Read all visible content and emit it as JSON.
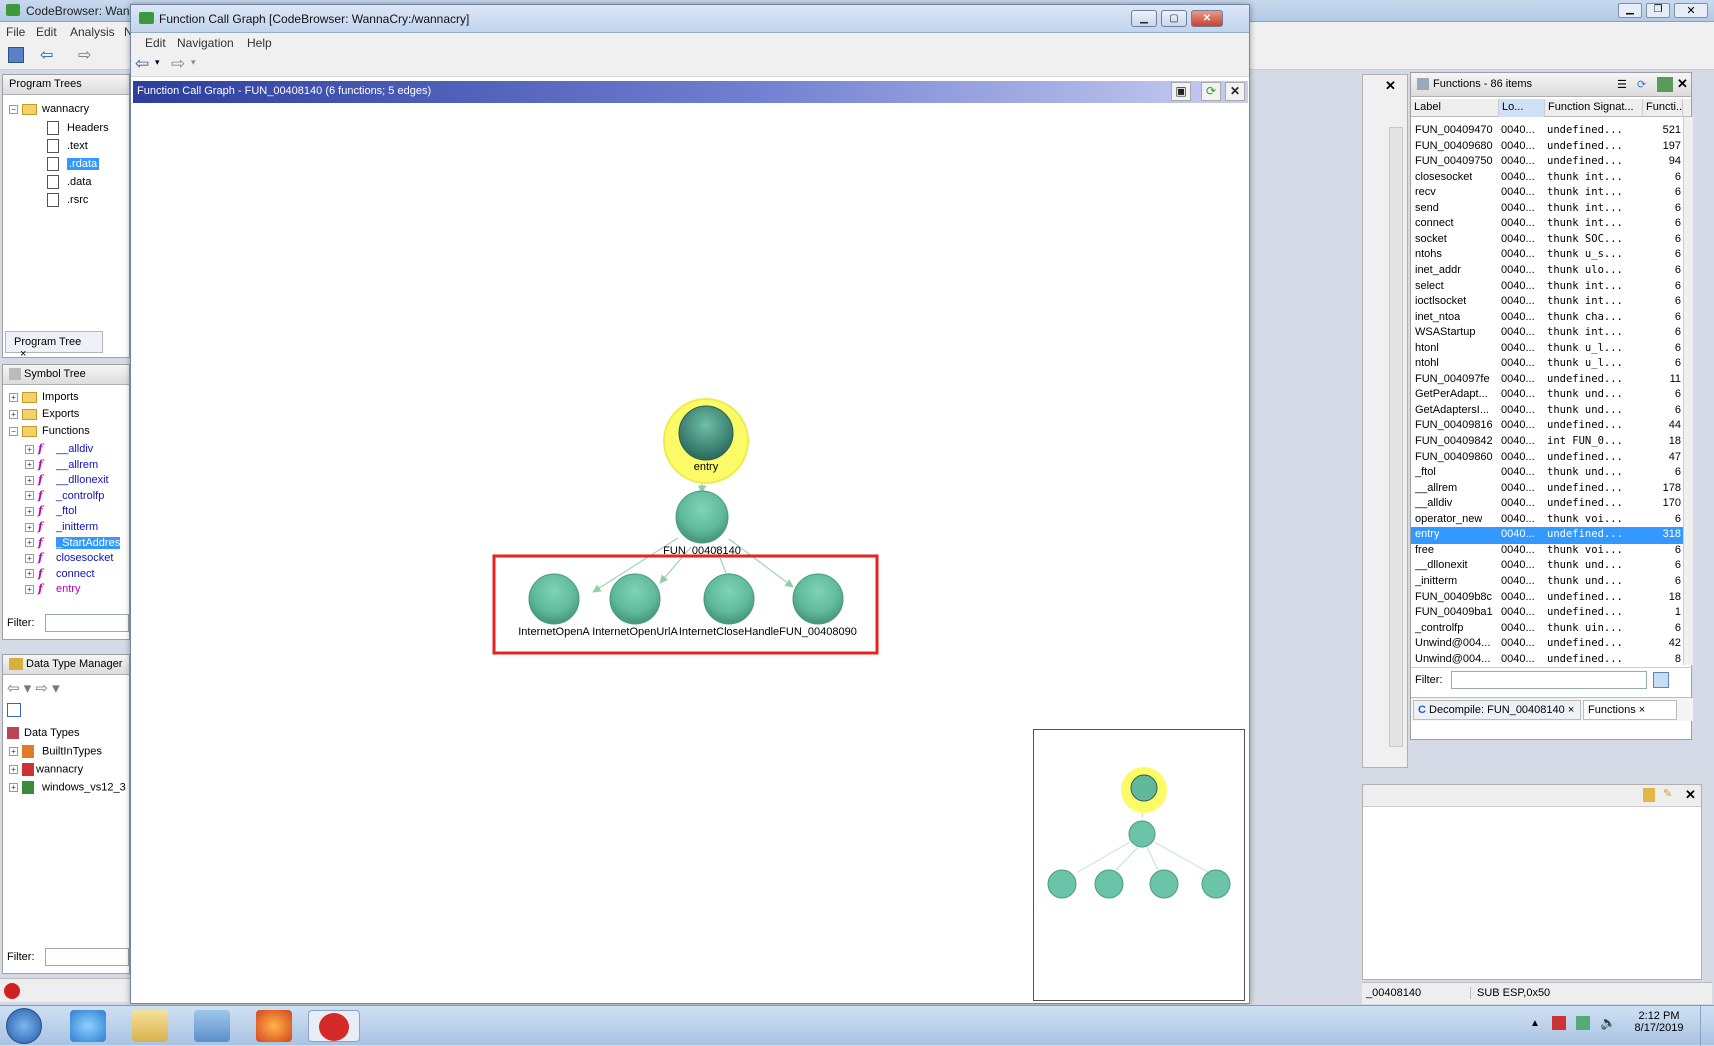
{
  "codebrowser": {
    "title": "CodeBrowser: Wann",
    "menu": [
      "File",
      "Edit",
      "Analysis",
      "N"
    ]
  },
  "program_trees": {
    "title": "Program Trees",
    "root": "wannacry",
    "items": [
      "Headers",
      ".text",
      ".rdata",
      ".data",
      ".rsrc"
    ],
    "tab": "Program Tree"
  },
  "symbol_tree": {
    "title": "Symbol Tree",
    "folders": [
      "Imports",
      "Exports",
      "Functions"
    ],
    "functions": [
      "__alldiv",
      "__allrem",
      "__dllonexit",
      "_controlfp",
      "_ftol",
      "_initterm",
      "_StartAddres",
      "closesocket",
      "connect",
      "entry"
    ],
    "filter_label": "Filter:"
  },
  "data_type_manager": {
    "title": "Data Type Manager",
    "root": "Data Types",
    "items": [
      "BuiltInTypes",
      "wannacry",
      "windows_vs12_3"
    ],
    "filter_label": "Filter:"
  },
  "fcg_window": {
    "title": "Function Call Graph [CodeBrowser: WannaCry:/wannacry]",
    "menu": [
      "Edit",
      "Navigation",
      "Help"
    ],
    "panel_title": "Function Call Graph - FUN_00408140 (6 functions; 5 edges)"
  },
  "graph": {
    "root": "entry",
    "caller": "FUN_00408140",
    "callees": [
      "InternetOpenA",
      "InternetOpenUrlA",
      "InternetCloseHandle",
      "FUN_00408090"
    ],
    "node_color": "#6cc4a8",
    "highlight_color": "#ffff66",
    "box_color": "#e8231f"
  },
  "functions_panel": {
    "title": "Functions - 86 items",
    "columns": [
      "Label",
      "Lo...",
      "Function Signat...",
      "Functi..."
    ],
    "rows": [
      [
        "FUN_00409470",
        "0040...",
        "undefined...",
        "521"
      ],
      [
        "FUN_00409680",
        "0040...",
        "undefined...",
        "197"
      ],
      [
        "FUN_00409750",
        "0040...",
        "undefined...",
        "94"
      ],
      [
        "closesocket",
        "0040...",
        "thunk int...",
        "6"
      ],
      [
        "recv",
        "0040...",
        "thunk int...",
        "6"
      ],
      [
        "send",
        "0040...",
        "thunk int...",
        "6"
      ],
      [
        "connect",
        "0040...",
        "thunk int...",
        "6"
      ],
      [
        "socket",
        "0040...",
        "thunk SOC...",
        "6"
      ],
      [
        "ntohs",
        "0040...",
        "thunk u_s...",
        "6"
      ],
      [
        "inet_addr",
        "0040...",
        "thunk ulo...",
        "6"
      ],
      [
        "select",
        "0040...",
        "thunk int...",
        "6"
      ],
      [
        "ioctlsocket",
        "0040...",
        "thunk int...",
        "6"
      ],
      [
        "inet_ntoa",
        "0040...",
        "thunk cha...",
        "6"
      ],
      [
        "WSAStartup",
        "0040...",
        "thunk int...",
        "6"
      ],
      [
        "htonl",
        "0040...",
        "thunk u_l...",
        "6"
      ],
      [
        "ntohl",
        "0040...",
        "thunk u_l...",
        "6"
      ],
      [
        "FUN_004097fe",
        "0040...",
        "undefined...",
        "11"
      ],
      [
        "GetPerAdapt...",
        "0040...",
        "thunk und...",
        "6"
      ],
      [
        "GetAdaptersI...",
        "0040...",
        "thunk und...",
        "6"
      ],
      [
        "FUN_00409816",
        "0040...",
        "undefined...",
        "44"
      ],
      [
        "FUN_00409842",
        "0040...",
        "int FUN_0...",
        "18"
      ],
      [
        "FUN_00409860",
        "0040...",
        "undefined...",
        "47"
      ],
      [
        "_ftol",
        "0040...",
        "thunk und...",
        "6"
      ],
      [
        "__allrem",
        "0040...",
        "undefined...",
        "178"
      ],
      [
        "__alldiv",
        "0040...",
        "undefined...",
        "170"
      ],
      [
        "operator_new",
        "0040...",
        "thunk voi...",
        "6"
      ],
      [
        "entry",
        "0040...",
        "undefined...",
        "318"
      ],
      [
        "free",
        "0040...",
        "thunk voi...",
        "6"
      ],
      [
        "__dllonexit",
        "0040...",
        "thunk und...",
        "6"
      ],
      [
        "_initterm",
        "0040...",
        "thunk und...",
        "6"
      ],
      [
        "FUN_00409b8c",
        "0040...",
        "undefined...",
        "18"
      ],
      [
        "FUN_00409ba1",
        "0040...",
        "undefined...",
        "1"
      ],
      [
        "_controlfp",
        "0040...",
        "thunk uin...",
        "6"
      ],
      [
        "Unwind@004...",
        "0040...",
        "undefined...",
        "42"
      ],
      [
        "Unwind@004...",
        "0040...",
        "undefined...",
        "8"
      ]
    ],
    "selected_row": "entry",
    "filter_label": "Filter:",
    "tabs": [
      "Decompile: FUN_00408140",
      "Functions"
    ]
  },
  "status_bar": {
    "address": "_00408140",
    "instruction": "SUB ESP,0x50"
  },
  "taskbar": {
    "time": "2:12 PM",
    "date": "8/17/2019"
  }
}
